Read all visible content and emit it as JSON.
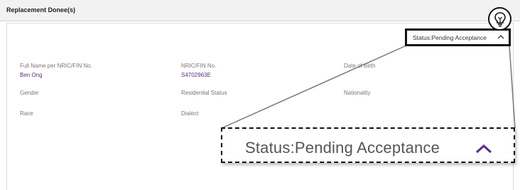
{
  "section": {
    "title": "Replacement Donee(s)"
  },
  "status": {
    "text": "Status:Pending Acceptance",
    "zoomed_text": "Status:Pending Acceptance",
    "chevron_color": "#5b2a86"
  },
  "fields": {
    "full_name_label": "Full Name per NRIC/FIN No.",
    "full_name_value": "Ben Ong",
    "nric_label": "NRIC/FIN No.",
    "nric_value": "S4702963E",
    "dob_label": "Date of Birth",
    "gender_label": "Gender",
    "residential_label": "Residential Status",
    "nationality_label": "Nationality",
    "race_label": "Race",
    "dialect_label": "Dialect"
  },
  "icons": {
    "hint": "lightbulb-icon",
    "chevron": "chevron-up-icon"
  },
  "colors": {
    "value_text": "#5b2a86",
    "header_bg": "#f2f2f2"
  }
}
